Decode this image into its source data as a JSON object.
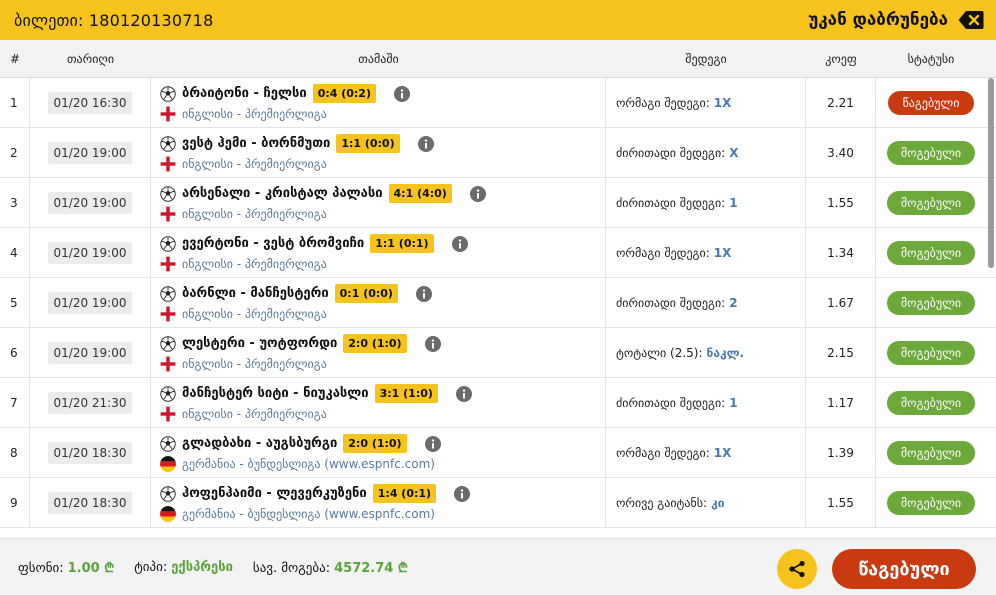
{
  "header": {
    "ticket_label": "ბილეთი: 180120130718",
    "back_label": "უკან დაბრუნება"
  },
  "columns": {
    "num": "#",
    "date": "თარიღი",
    "match": "თამაში",
    "outcome": "შედეგი",
    "odds": "კოეფ",
    "status": "სტატუსი"
  },
  "rows": [
    {
      "num": "1",
      "date": "01/20 16:30",
      "teams": "ბრაიტონი - ჩელსი",
      "score": "0:4 (0:2)",
      "flag": "england",
      "league": "ინგლისი - პრემიერლიგა",
      "outcome_label": "ორმაგი შედეგი:",
      "outcome_value": "1X",
      "odds": "2.21",
      "status": "წაგებული",
      "status_type": "lost"
    },
    {
      "num": "2",
      "date": "01/20 19:00",
      "teams": "ვესტ ჰემი - ბორნმუთი",
      "score": "1:1 (0:0)",
      "flag": "england",
      "league": "ინგლისი - პრემიერლიგა",
      "outcome_label": "ძირითადი შედეგი:",
      "outcome_value": "X",
      "odds": "3.40",
      "status": "მოგებული",
      "status_type": "won"
    },
    {
      "num": "3",
      "date": "01/20 19:00",
      "teams": "არსენალი - კრისტალ პალასი",
      "score": "4:1 (4:0)",
      "flag": "england",
      "league": "ინგლისი - პრემიერლიგა",
      "outcome_label": "ძირითადი შედეგი:",
      "outcome_value": "1",
      "odds": "1.55",
      "status": "მოგებული",
      "status_type": "won"
    },
    {
      "num": "4",
      "date": "01/20 19:00",
      "teams": "ევერტონი - ვესტ ბრომვიჩი",
      "score": "1:1 (0:1)",
      "flag": "england",
      "league": "ინგლისი - პრემიერლიგა",
      "outcome_label": "ორმაგი შედეგი:",
      "outcome_value": "1X",
      "odds": "1.34",
      "status": "მოგებული",
      "status_type": "won"
    },
    {
      "num": "5",
      "date": "01/20 19:00",
      "teams": "ბარნლი - მანჩესტერი",
      "score": "0:1 (0:0)",
      "flag": "england",
      "league": "ინგლისი - პრემიერლიგა",
      "outcome_label": "ძირითადი შედეგი:",
      "outcome_value": "2",
      "odds": "1.67",
      "status": "მოგებული",
      "status_type": "won"
    },
    {
      "num": "6",
      "date": "01/20 19:00",
      "teams": "ლესტერი - უოტფორდი",
      "score": "2:0 (1:0)",
      "flag": "england",
      "league": "ინგლისი - პრემიერლიგა",
      "outcome_label": "ტოტალი (2.5):",
      "outcome_value": "ნაკლ.",
      "odds": "2.15",
      "status": "მოგებული",
      "status_type": "won"
    },
    {
      "num": "7",
      "date": "01/20 21:30",
      "teams": "მანჩესტერ სიტი - ნიუკასლი",
      "score": "3:1 (1:0)",
      "flag": "england",
      "league": "ინგლისი - პრემიერლიგა",
      "outcome_label": "ძირითადი შედეგი:",
      "outcome_value": "1",
      "odds": "1.17",
      "status": "მოგებული",
      "status_type": "won"
    },
    {
      "num": "8",
      "date": "01/20 18:30",
      "teams": "გლადბახი - აუგსბურგი",
      "score": "2:0 (1:0)",
      "flag": "germany",
      "league": "გერმანია - ბუნდესლიგა (www.espnfc.com)",
      "outcome_label": "ორმაგი შედეგი:",
      "outcome_value": "1X",
      "odds": "1.39",
      "status": "მოგებული",
      "status_type": "won"
    },
    {
      "num": "9",
      "date": "01/20 18:30",
      "teams": "ჰოფენჰაიმი - ლევერკუზენი",
      "score": "1:4 (0:1)",
      "flag": "germany",
      "league": "გერმანია - ბუნდესლიგა (www.espnfc.com)",
      "outcome_label": "ორივე გაიტანს:",
      "outcome_value": "კი",
      "odds": "1.55",
      "status": "მოგებული",
      "status_type": "won"
    }
  ],
  "footer": {
    "bet_label": "ფსონი:",
    "bet_value": "1.00 ₾",
    "type_label": "ტიპი:",
    "type_value": "ექსპრესი",
    "win_label": "სავ. მოგება:",
    "win_value": "4572.74 ₾",
    "final_status": "წაგებული"
  },
  "colors": {
    "accent": "#f5c31c",
    "lost": "#c93a12",
    "won": "#6aa93a",
    "link": "#4a7aa8"
  },
  "icons": {
    "back": "backspace-icon",
    "ball": "soccer-ball-icon",
    "info": "info-icon",
    "share": "share-icon"
  }
}
